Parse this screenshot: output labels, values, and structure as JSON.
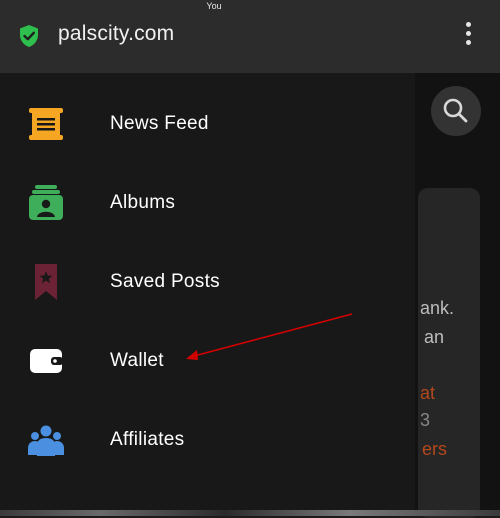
{
  "status_bar": {
    "user_label": "You"
  },
  "browser": {
    "url": "palscity.com"
  },
  "drawer": {
    "items": [
      {
        "label": "News Feed",
        "icon": "newspaper-icon"
      },
      {
        "label": "Albums",
        "icon": "albums-icon"
      },
      {
        "label": "Saved Posts",
        "icon": "bookmark-icon"
      },
      {
        "label": "Wallet",
        "icon": "wallet-icon"
      },
      {
        "label": "Affiliates",
        "icon": "people-icon"
      }
    ]
  },
  "background_page": {
    "fragments": [
      "ank.",
      "an",
      "at",
      "3",
      "ers"
    ]
  },
  "colors": {
    "accent_orange": "#f5a623",
    "albums_green": "#3fae5b",
    "bookmark_maroon": "#6b2234",
    "affiliates_blue": "#4a8fe0",
    "annotation_red": "#d40000",
    "shield_green": "#2fbf4f"
  }
}
